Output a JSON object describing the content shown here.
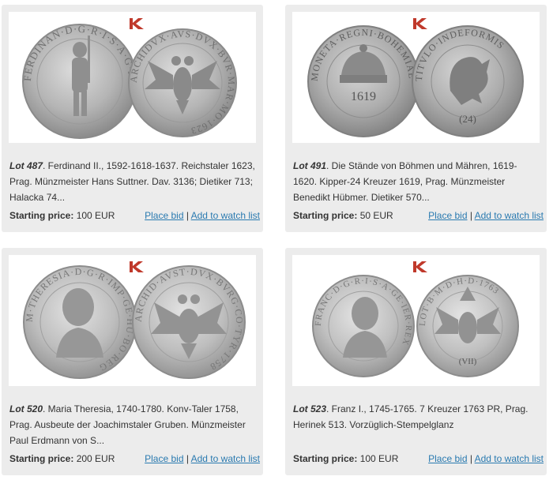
{
  "lots": [
    {
      "lot_label": "Lot 487",
      "description": ". Ferdinand II., 1592-1618-1637. Reichstaler 1623, Prag. Münzmeister Hans Suttner. Dav. 3136; Dietiker 713; Halacka 74...",
      "price_label": "Starting price:",
      "price_value": " 100 EUR",
      "bid_label": "Place bid",
      "separator": " | ",
      "watch_label": "Add to watch list",
      "obverse_legend": "FERDINAN·D·G·R·I·S·A·G·HV",
      "reverse_legend": "ARCHIDVX·AVS·DVX·BVR·MAR·MO·1623"
    },
    {
      "lot_label": "Lot 491",
      "description": ". Die Stände von Böhmen und Mähren, 1619-1620. Kipper-24 Kreuzer 1619, Prag. Münzmeister Benedikt Hübmer. Dietiker 570...",
      "price_label": "Starting price:",
      "price_value": " 50 EUR",
      "bid_label": "Place bid",
      "separator": " | ",
      "watch_label": "Add to watch list",
      "obverse_legend": "MONETA·REGNI·BOHEMIAE",
      "reverse_legend": "TITVLO·INDEFORMIS",
      "obverse_date": "1619",
      "reverse_value": "(24)"
    },
    {
      "lot_label": "Lot 520",
      "description": ". Maria Theresia, 1740-1780. Konv-Taler 1758, Prag. Ausbeute der Joachimstaler Gruben. Münzmeister Paul Erdmann von S...",
      "price_label": "Starting price:",
      "price_value": " 200 EUR",
      "bid_label": "Place bid",
      "separator": " | ",
      "watch_label": "Add to watch list",
      "obverse_legend": "M·THERESIA·D·G·R·IMP·GE·HU·BO·REG",
      "reverse_legend": "ARCHID·AVST·DVX·BVRG·CO·TYR·1758"
    },
    {
      "lot_label": "Lot 523",
      "description": ". Franz I., 1745-1765. 7 Kreuzer 1763 PR, Prag. Herinek 513. Vorzüglich-Stempelglanz",
      "price_label": "Starting price:",
      "price_value": " 100 EUR",
      "bid_label": "Place bid",
      "separator": " | ",
      "watch_label": "Add to watch list",
      "obverse_legend": "FRANC·D·G·R·I·S·A·GE·IER·REX",
      "reverse_legend": "LOT·B·M·D·H·D·1763",
      "reverse_value": "(VII)"
    }
  ],
  "colors": {
    "card_bg": "#ececec",
    "link": "#2a7ab0",
    "badge": "#c0392b",
    "coin_silver": "#b9b9b9"
  },
  "icons": {
    "badge": "auction-house-logo-icon"
  }
}
